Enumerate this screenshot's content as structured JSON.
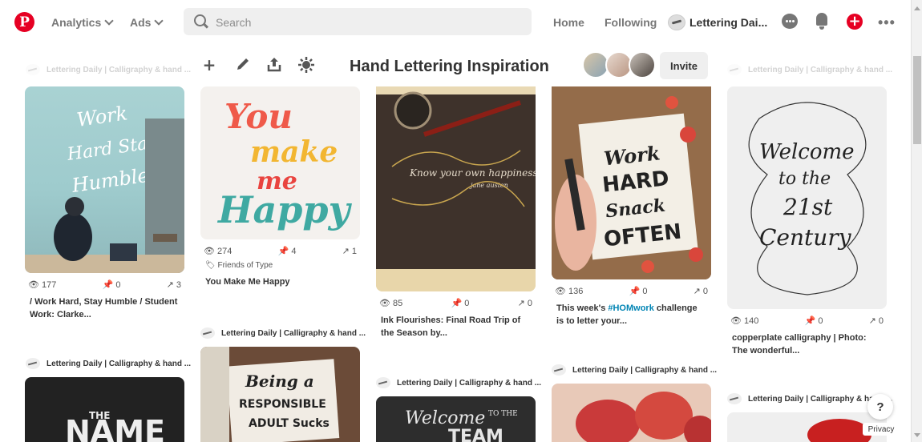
{
  "nav": {
    "analytics": "Analytics",
    "ads": "Ads",
    "search_placeholder": "Search",
    "home": "Home",
    "following": "Following",
    "profile": "Lettering Dai..."
  },
  "board": {
    "title": "Hand Lettering Inspiration",
    "invite": "Invite"
  },
  "attribution": "Lettering Daily | Calligraphy & hand ...",
  "pins": [
    {
      "views": "177",
      "saves": "0",
      "shares": "3",
      "desc": "/ Work Hard, Stay Humble / Student Work: Clarke...",
      "img_text": "Work Hard Stay Humble"
    },
    {
      "views": "274",
      "saves": "4",
      "shares": "1",
      "source": "Friends of Type",
      "desc": "You Make Me Happy",
      "img_text": "You make me Happy"
    },
    {
      "views": "85",
      "saves": "0",
      "shares": "0",
      "desc": "Ink Flourishes: Final Road Trip of the Season by...",
      "img_text": "Know your own happiness"
    },
    {
      "views": "136",
      "saves": "0",
      "shares": "0",
      "desc_pre": "This week's ",
      "desc_tag": "#HOMwork",
      "desc_post": " challenge is to letter your...",
      "img_text": "Work Hard Snack Often"
    },
    {
      "views": "140",
      "saves": "0",
      "shares": "0",
      "desc": "copperplate calligraphy | Photo: The wonderful...",
      "img_text": "Welcome to the 21st Century"
    }
  ],
  "lower_pins": [
    {
      "img_text": "THE NAME"
    },
    {
      "img_text": "Being a Responsible Adult Sucks"
    },
    {
      "img_text": "Welcome to the TEAM"
    }
  ],
  "help": "?",
  "privacy": "Privacy"
}
